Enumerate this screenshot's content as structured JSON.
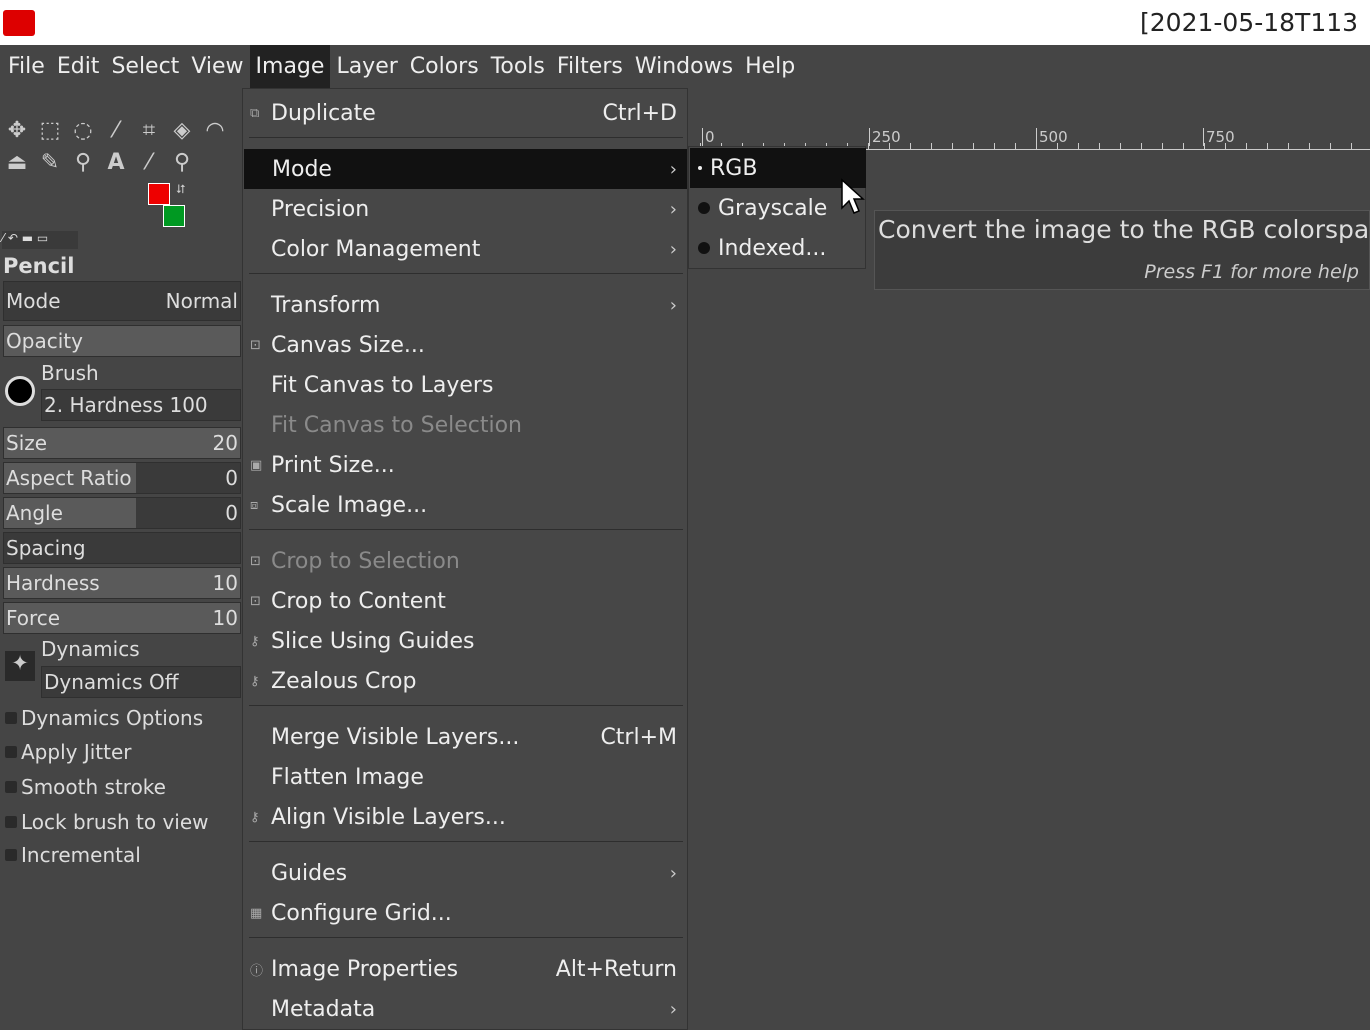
{
  "titlebar": {
    "title": "[2021-05-18T113"
  },
  "menubar": [
    "File",
    "Edit",
    "Select",
    "View",
    "Image",
    "Layer",
    "Colors",
    "Tools",
    "Filters",
    "Windows",
    "Help"
  ],
  "colors": {
    "foreground": "#ee0000",
    "background": "#009922"
  },
  "tool_options": {
    "tool": "Pencil",
    "mode_label": "Mode",
    "mode_value": "Normal",
    "opacity_label": "Opacity",
    "brush_label": "Brush",
    "brush_value": "2. Hardness 100",
    "size_label": "Size",
    "size_value": "20",
    "aspect_label": "Aspect Ratio",
    "aspect_value": "0",
    "angle_label": "Angle",
    "angle_value": "0",
    "spacing_label": "Spacing",
    "hardness_label": "Hardness",
    "hardness_value": "10",
    "force_label": "Force",
    "force_value": "10",
    "dynamics_label": "Dynamics",
    "dynamics_value": "Dynamics Off",
    "checks": [
      "Dynamics Options",
      "Apply Jitter",
      "Smooth stroke",
      "Lock brush to view",
      "Incremental"
    ]
  },
  "image_menu": [
    {
      "label": "Duplicate",
      "accel": "Ctrl+D"
    },
    {
      "label": "Mode",
      "submenu": true
    },
    {
      "label": "Precision",
      "submenu": true
    },
    {
      "label": "Color Management",
      "submenu": true
    },
    {
      "label": "Transform",
      "submenu": true
    },
    {
      "label": "Canvas Size..."
    },
    {
      "label": "Fit Canvas to Layers"
    },
    {
      "label": "Fit Canvas to Selection",
      "disabled": true
    },
    {
      "label": "Print Size..."
    },
    {
      "label": "Scale Image..."
    },
    {
      "label": "Crop to Selection",
      "disabled": true
    },
    {
      "label": "Crop to Content"
    },
    {
      "label": "Slice Using Guides"
    },
    {
      "label": "Zealous Crop"
    },
    {
      "label": "Merge Visible Layers...",
      "accel": "Ctrl+M"
    },
    {
      "label": "Flatten Image"
    },
    {
      "label": "Align Visible Layers..."
    },
    {
      "label": "Guides",
      "submenu": true
    },
    {
      "label": "Configure Grid..."
    },
    {
      "label": "Image Properties",
      "accel": "Alt+Return"
    },
    {
      "label": "Metadata",
      "submenu": true
    }
  ],
  "mode_submenu": [
    "RGB",
    "Grayscale",
    "Indexed..."
  ],
  "ruler": [
    "0",
    "250",
    "500",
    "750"
  ],
  "tooltip": {
    "text": "Convert the image to the RGB colorspace",
    "help": "Press F1 for more help"
  }
}
